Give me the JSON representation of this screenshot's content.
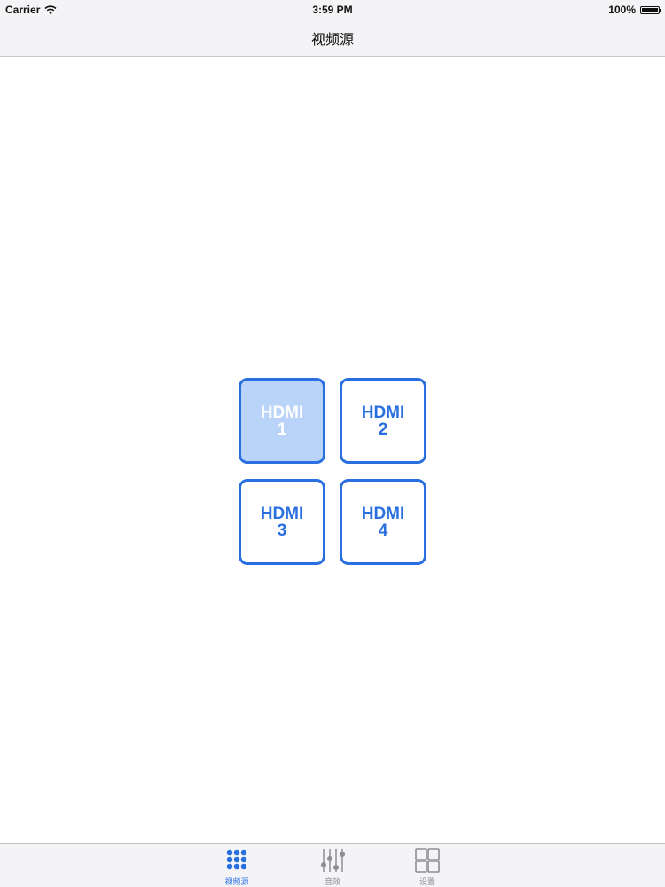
{
  "status_bar": {
    "carrier": "Carrier",
    "time": "3:59 PM",
    "battery_text": "100%",
    "battery_level": 1.0
  },
  "nav": {
    "title": "视频源"
  },
  "sources": [
    {
      "line1": "HDMI",
      "line2": "1",
      "selected": true
    },
    {
      "line1": "HDMI",
      "line2": "2",
      "selected": false
    },
    {
      "line1": "HDMI",
      "line2": "3",
      "selected": false
    },
    {
      "line1": "HDMI",
      "line2": "4",
      "selected": false
    }
  ],
  "tabs": [
    {
      "label": "视频源",
      "icon": "grid-dots-icon",
      "active": true
    },
    {
      "label": "音效",
      "icon": "equalizer-sliders-icon",
      "active": false
    },
    {
      "label": "设置",
      "icon": "four-squares-icon",
      "active": false
    }
  ],
  "colors": {
    "accent": "#2a6fe0",
    "selected_fill": "#b9d4f8",
    "bar_background": "#f4f4f6",
    "inactive_tab": "#8e8e93"
  }
}
